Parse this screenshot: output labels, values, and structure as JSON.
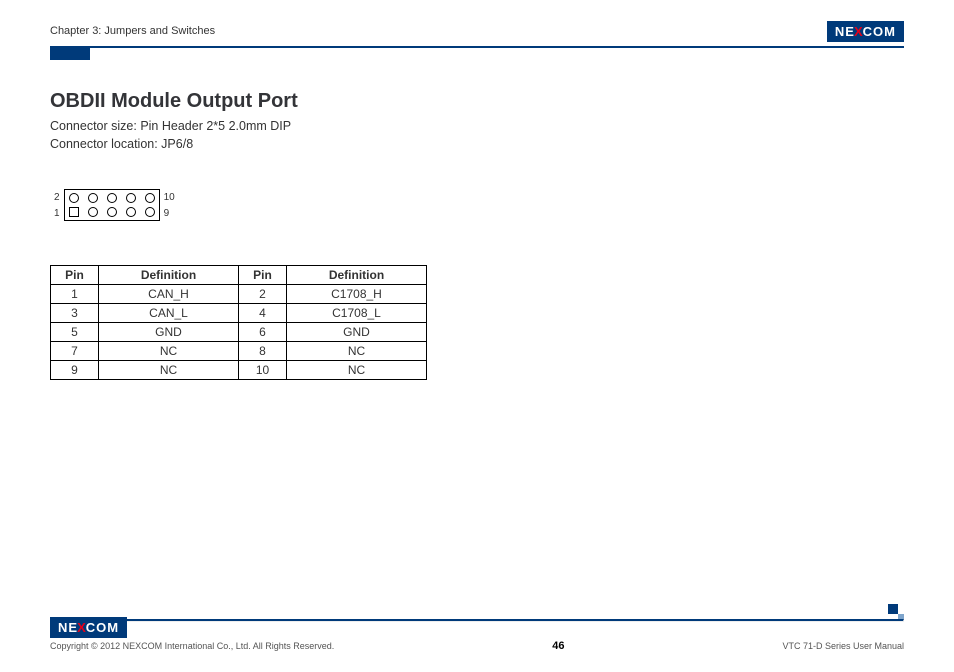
{
  "header": {
    "chapter_label": "Chapter 3: Jumpers and Switches",
    "logo_text_left": "NE",
    "logo_text_x": "X",
    "logo_text_right": "COM"
  },
  "section": {
    "title": "OBDII Module Output Port",
    "connector_size": "Connector size: Pin Header 2*5 2.0mm DIP",
    "connector_location": "Connector location: JP6/8"
  },
  "diagram": {
    "left_top": "2",
    "left_bottom": "1",
    "right_top": "10",
    "right_bottom": "9"
  },
  "table": {
    "headers": {
      "pin": "Pin",
      "definition": "Definition"
    },
    "rows": [
      {
        "p1": "1",
        "d1": "CAN_H",
        "p2": "2",
        "d2": "C1708_H"
      },
      {
        "p1": "3",
        "d1": "CAN_L",
        "p2": "4",
        "d2": "C1708_L"
      },
      {
        "p1": "5",
        "d1": "GND",
        "p2": "6",
        "d2": "GND"
      },
      {
        "p1": "7",
        "d1": "NC",
        "p2": "8",
        "d2": "NC"
      },
      {
        "p1": "9",
        "d1": "NC",
        "p2": "10",
        "d2": "NC"
      }
    ]
  },
  "footer": {
    "copyright": "Copyright © 2012 NEXCOM International Co., Ltd. All Rights Reserved.",
    "page_number": "46",
    "manual": "VTC 71-D Series User Manual"
  }
}
